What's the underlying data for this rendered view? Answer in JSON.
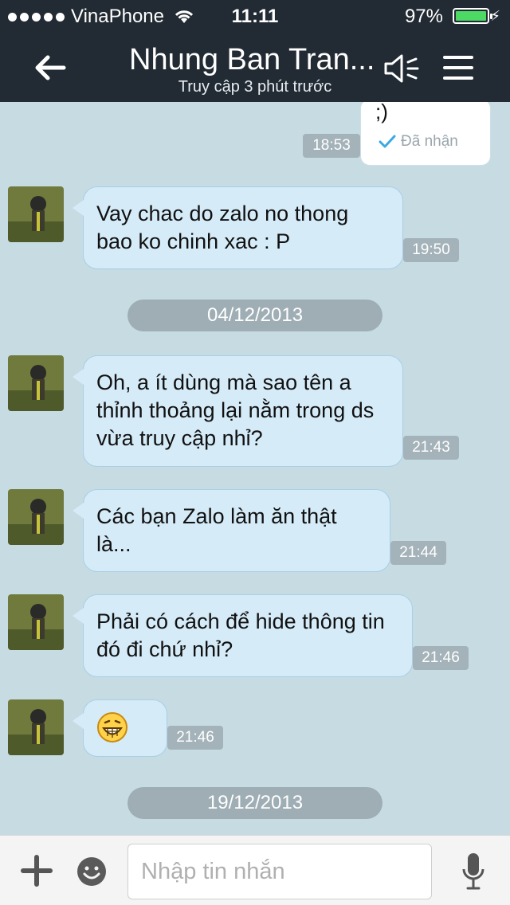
{
  "status_bar": {
    "carrier": "VinaPhone",
    "time": "11:11",
    "battery": "97%"
  },
  "header": {
    "title": "Nhung Ban Tran...",
    "subtitle": "Truy cập 3 phút trước"
  },
  "messages": {
    "out_partial": {
      "text": ";)",
      "time": "18:53",
      "status": "Đã nhận"
    },
    "m1": {
      "text": "Vay chac do zalo no thong bao ko chinh xac : P",
      "time": "19:50"
    },
    "date1": "04/12/2013",
    "m2": {
      "text": "Oh, a ít dùng mà sao tên a thỉnh thoảng lại nằm trong ds vừa truy cập nhỉ?",
      "time": "21:43"
    },
    "m3": {
      "text": "Các bạn Zalo làm ăn thật là...",
      "time": "21:44"
    },
    "m4": {
      "text": "Phải có cách để hide thông tin đó đi chứ nhỉ?",
      "time": "21:46"
    },
    "m5": {
      "time": "21:46"
    },
    "date2": "19/12/2013"
  },
  "input": {
    "placeholder": "Nhập tin nhắn"
  },
  "colors": {
    "nav": "#222a33",
    "chat_bg": "#c7dbe3",
    "bubble": "#d5ebf8",
    "battery": "#4cd964",
    "check": "#3aa9e6"
  }
}
